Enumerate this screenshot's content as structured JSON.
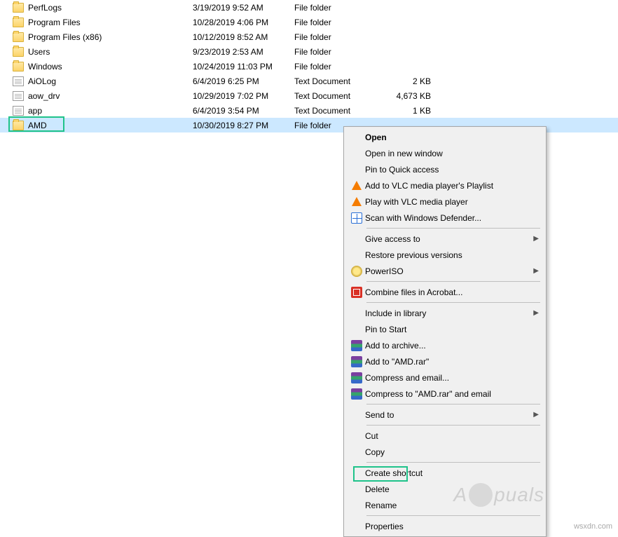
{
  "files": [
    {
      "name": "PerfLogs",
      "date": "3/19/2019 9:52 AM",
      "type": "File folder",
      "size": "",
      "icon": "folder"
    },
    {
      "name": "Program Files",
      "date": "10/28/2019 4:06 PM",
      "type": "File folder",
      "size": "",
      "icon": "folder"
    },
    {
      "name": "Program Files (x86)",
      "date": "10/12/2019 8:52 AM",
      "type": "File folder",
      "size": "",
      "icon": "folder"
    },
    {
      "name": "Users",
      "date": "9/23/2019 2:53 AM",
      "type": "File folder",
      "size": "",
      "icon": "folder"
    },
    {
      "name": "Windows",
      "date": "10/24/2019 11:03 PM",
      "type": "File folder",
      "size": "",
      "icon": "folder"
    },
    {
      "name": "AiOLog",
      "date": "6/4/2019 6:25 PM",
      "type": "Text Document",
      "size": "2 KB",
      "icon": "file"
    },
    {
      "name": "aow_drv",
      "date": "10/29/2019 7:02 PM",
      "type": "Text Document",
      "size": "4,673 KB",
      "icon": "file"
    },
    {
      "name": "app",
      "date": "6/4/2019 3:54 PM",
      "type": "Text Document",
      "size": "1 KB",
      "icon": "file"
    },
    {
      "name": "AMD",
      "date": "10/30/2019 8:27 PM",
      "type": "File folder",
      "size": "",
      "icon": "folder",
      "selected": true
    }
  ],
  "menu": {
    "open": "Open",
    "open_new": "Open in new window",
    "pin_quick": "Pin to Quick access",
    "vlc_add": "Add to VLC media player's Playlist",
    "vlc_play": "Play with VLC media player",
    "defender": "Scan with Windows Defender...",
    "give_access": "Give access to",
    "restore": "Restore previous versions",
    "poweriso": "PowerISO",
    "acrobat": "Combine files in Acrobat...",
    "include_lib": "Include in library",
    "pin_start": "Pin to Start",
    "rar_add": "Add to archive...",
    "rar_add_amd": "Add to \"AMD.rar\"",
    "rar_email": "Compress and email...",
    "rar_email_amd": "Compress to \"AMD.rar\" and email",
    "send_to": "Send to",
    "cut": "Cut",
    "copy": "Copy",
    "shortcut": "Create shortcut",
    "delete": "Delete",
    "rename": "Rename",
    "properties": "Properties"
  },
  "watermark": {
    "left": "A",
    "right": "puals"
  },
  "source": "wsxdn.com"
}
